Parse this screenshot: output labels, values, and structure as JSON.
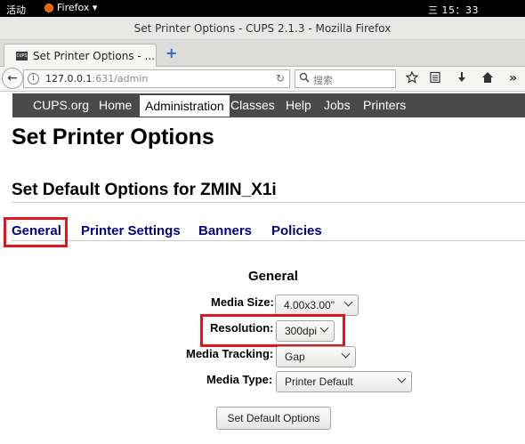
{
  "desktop": {
    "activities": "活动",
    "app_menu": "Firefox ▾",
    "clock": "三 15：33"
  },
  "window": {
    "title": "Set Printer Options - CUPS 2.1.3 - Mozilla Firefox"
  },
  "tabs": [
    {
      "favicon_text": "CUPS",
      "label": "Set Printer Options - ..."
    }
  ],
  "new_tab": "+",
  "toolbar": {
    "back_icon": "←",
    "url_host": "127.0.0.1",
    "url_rest": ":631/admin",
    "reload_icon": "↻",
    "search_placeholder": "搜索",
    "icons": [
      "star-icon",
      "reading-list-icon",
      "download-icon",
      "home-icon",
      "overflow-icon"
    ]
  },
  "cups_nav": {
    "items": [
      "CUPS.org",
      "Home",
      "Administration",
      "Classes",
      "Help",
      "Jobs",
      "Printers"
    ],
    "active": "Administration"
  },
  "page": {
    "title": "Set Printer Options",
    "subtitle": "Set Default Options for ZMIN_X1i",
    "tabs": [
      "General",
      "Printer Settings",
      "Banners",
      "Policies"
    ],
    "section_heading": "General",
    "fields": [
      {
        "label": "Media Size:",
        "value": "4.00x3.00\""
      },
      {
        "label": "Resolution:",
        "value": "300dpi"
      },
      {
        "label": "Media Tracking:",
        "value": "Gap"
      },
      {
        "label": "Media Type:",
        "value": "Printer Default"
      }
    ],
    "submit_label": "Set Default Options"
  },
  "colors": {
    "highlight": "#e3141d",
    "link": "#000080",
    "nav_bg": "#4a4a4a"
  }
}
